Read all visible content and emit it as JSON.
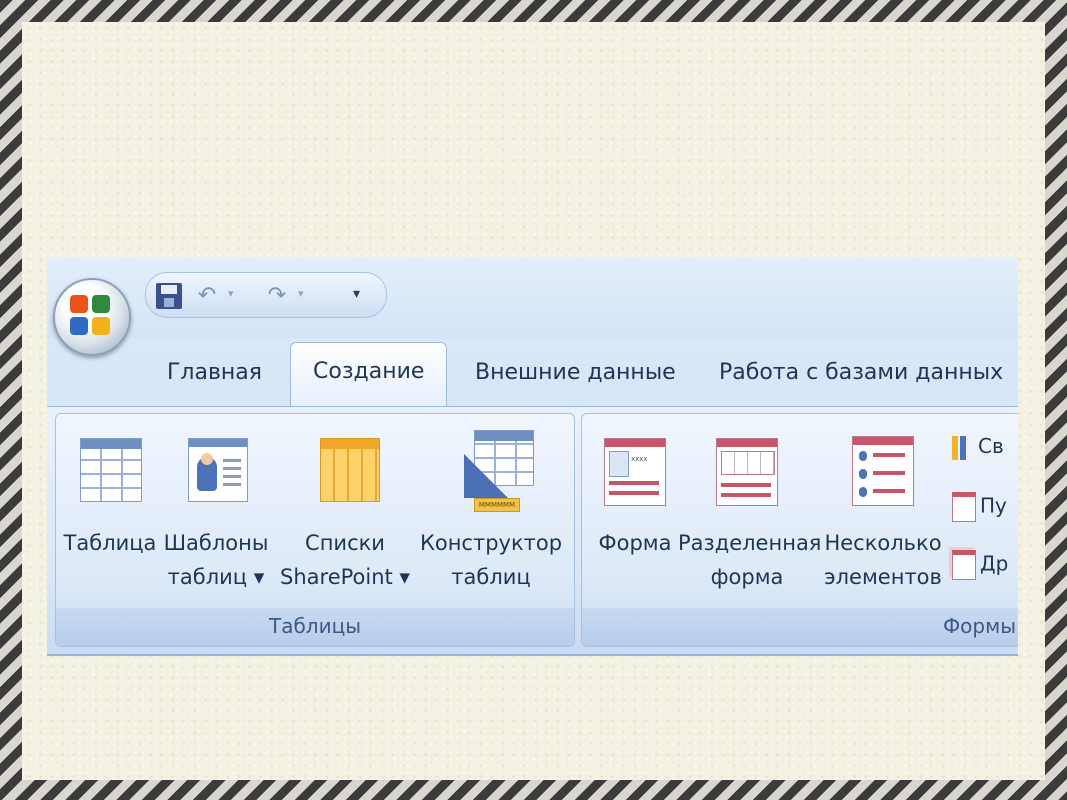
{
  "quick_access": {
    "save_icon": "save-icon",
    "undo_icon": "undo-icon",
    "redo_icon": "redo-icon",
    "dropdown_glyph": "▾",
    "more_glyph": "₹"
  },
  "tabs": [
    {
      "label": "Главная",
      "active": false
    },
    {
      "label": "Создание",
      "active": true
    },
    {
      "label": "Внешние данные",
      "active": false
    },
    {
      "label": "Работа с базами данных",
      "active": false
    }
  ],
  "groups": {
    "tables": {
      "label": "Таблицы",
      "buttons": [
        {
          "line1": "Таблица",
          "line2": ""
        },
        {
          "line1": "Шаблоны",
          "line2": "таблиц ▾"
        },
        {
          "line1": "Списки",
          "line2": "SharePoint ▾"
        },
        {
          "line1": "Конструктор",
          "line2": "таблиц"
        }
      ]
    },
    "forms": {
      "label": "Формы",
      "buttons": [
        {
          "line1": "Форма",
          "line2": ""
        },
        {
          "line1": "Разделенная",
          "line2": "форма"
        },
        {
          "line1": "Несколько",
          "line2": "элементов"
        }
      ],
      "small_items": [
        "Св",
        "Пу",
        "Др"
      ]
    }
  },
  "form_icon_text": "xxxx",
  "ruler_text": "MMMMMM",
  "colors": {
    "accent": "#1f3555",
    "ribbon_blue": "#dce9f8",
    "form_pink": "#c8566b"
  }
}
